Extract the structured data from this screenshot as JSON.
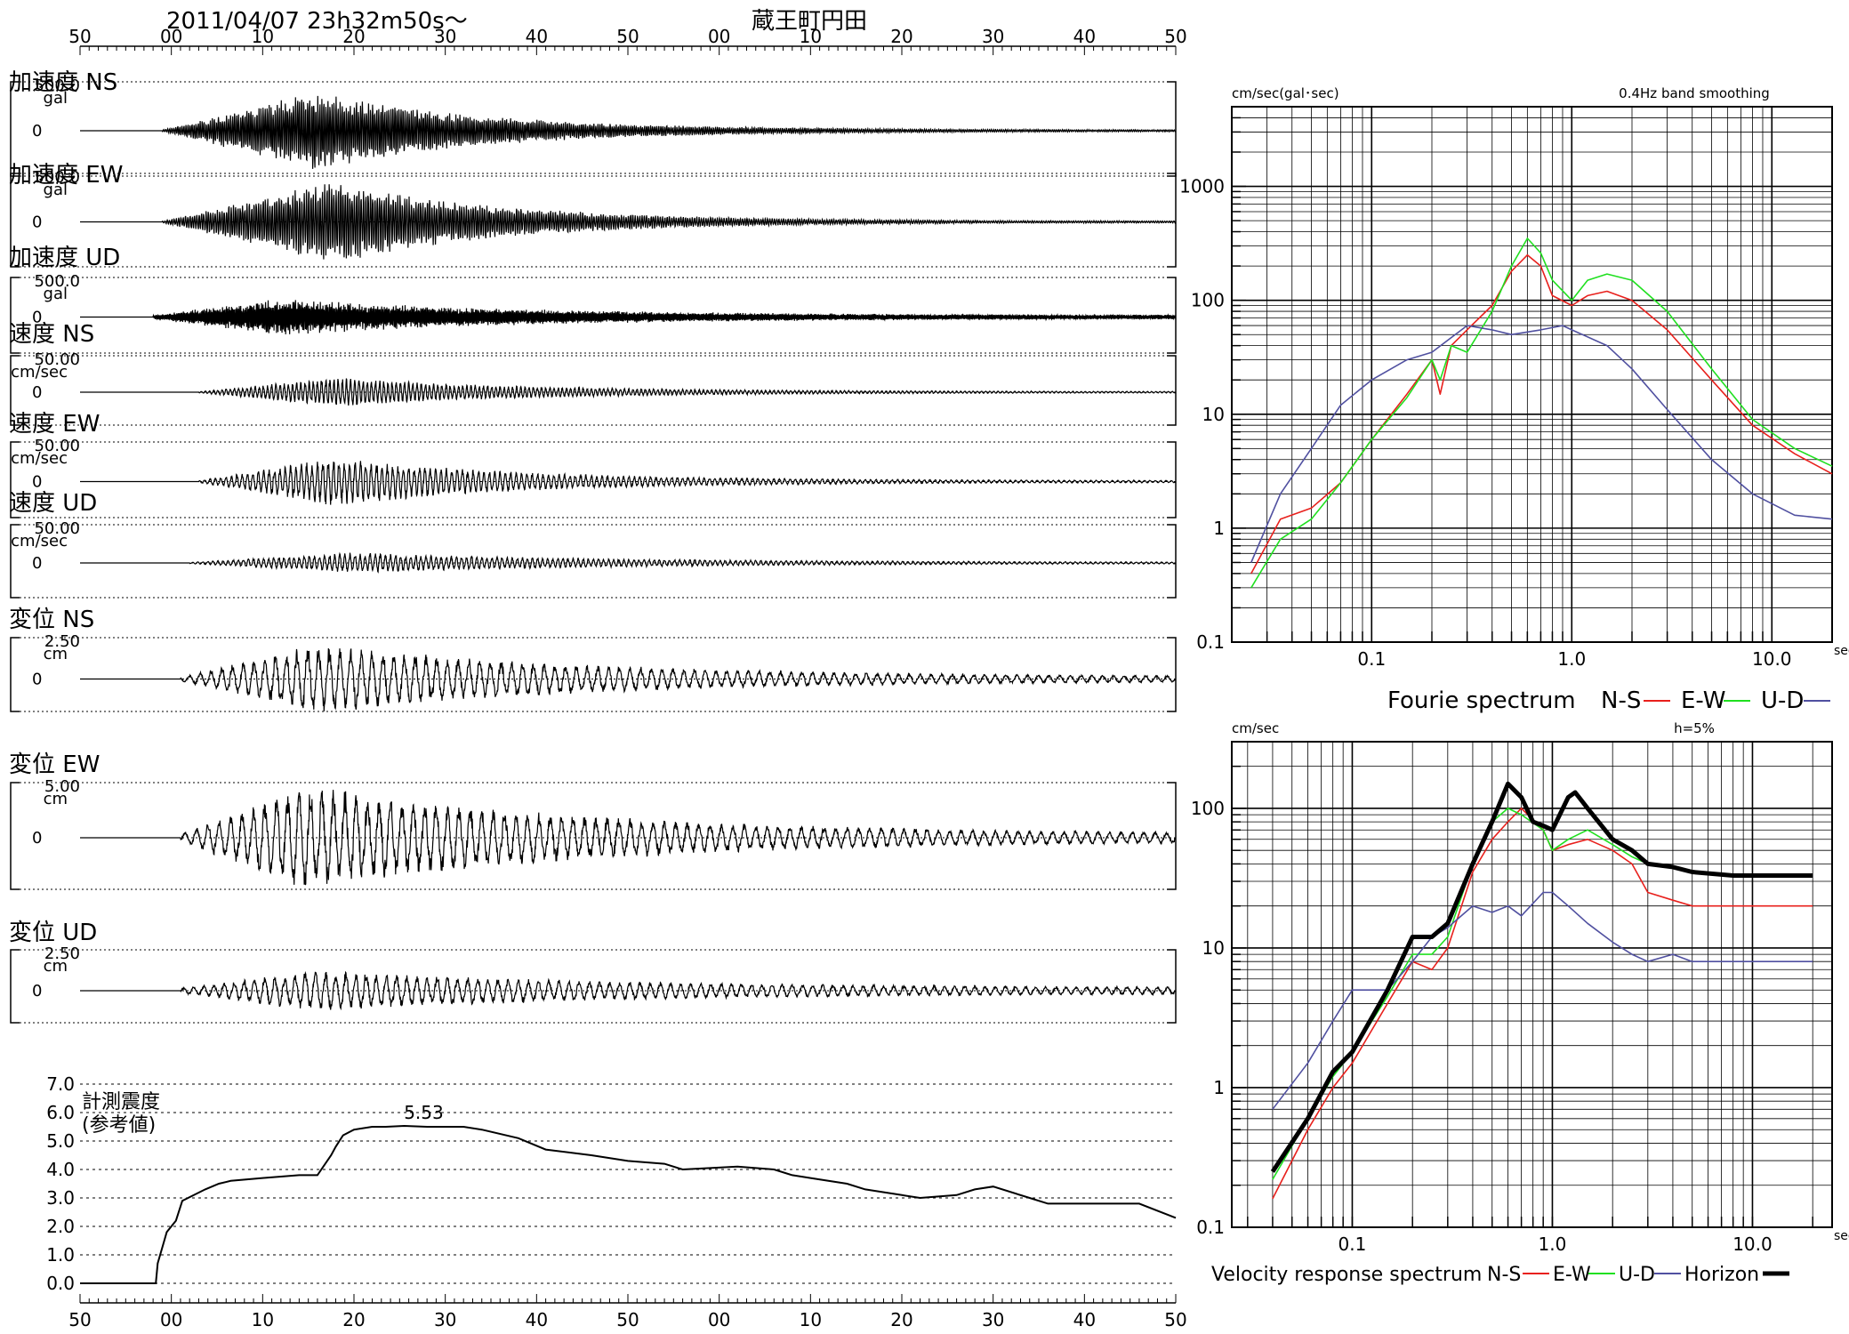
{
  "header": {
    "datetime": "2011/04/07  23h32m50s～",
    "station": "蔵王町円田"
  },
  "time_axis": {
    "ticks": [
      "50",
      "00",
      "10",
      "20",
      "30",
      "40",
      "50",
      "00",
      "10",
      "20",
      "30",
      "40",
      "50"
    ]
  },
  "waveform_panels": [
    {
      "title": "加速度 NS",
      "scale": "500.0",
      "unit": "gal",
      "zero": "0"
    },
    {
      "title": "加速度 EW",
      "scale": "500.0",
      "unit": "gal",
      "zero": "0"
    },
    {
      "title": "加速度 UD",
      "scale": "500.0",
      "unit": "gal",
      "zero": "0"
    },
    {
      "title": "速度 NS",
      "scale": "50.00",
      "unit": "cm/sec",
      "zero": "0"
    },
    {
      "title": "速度 EW",
      "scale": "50.00",
      "unit": "cm/sec",
      "zero": "0"
    },
    {
      "title": "速度 UD",
      "scale": "50.00",
      "unit": "cm/sec",
      "zero": "0"
    },
    {
      "title": "変位 NS",
      "scale": "2.50",
      "unit": "cm",
      "zero": "0"
    },
    {
      "title": "変位 EW",
      "scale": "5.00",
      "unit": "cm",
      "zero": "0"
    },
    {
      "title": "変位 UD",
      "scale": "2.50",
      "unit": "cm",
      "zero": "0"
    }
  ],
  "intensity_panel": {
    "label_line1": "計測震度",
    "label_line2": "(参考値)",
    "y_ticks": [
      "7.0",
      "6.0",
      "5.0",
      "4.0",
      "3.0",
      "2.0",
      "1.0",
      "0.0"
    ],
    "peak_label": "5.53"
  },
  "fourier_panel": {
    "ylabel": "cm/sec(gal･sec)",
    "note": "0.4Hz band smoothing",
    "y_ticks": [
      "1000",
      "100",
      "10",
      "1",
      "0.1"
    ],
    "x_ticks": [
      "0.1",
      "1.0",
      "10.0"
    ],
    "x_unit": "sec",
    "title": "Fourie spectrum",
    "legend": [
      {
        "label": "N-S",
        "color": "#e8201c"
      },
      {
        "label": "E-W",
        "color": "#20e020"
      },
      {
        "label": "U-D",
        "color": "#5050a0"
      }
    ]
  },
  "response_panel": {
    "ylabel": "cm/sec",
    "note": "h=5%",
    "y_ticks": [
      "100",
      "10",
      "1",
      "0.1"
    ],
    "x_ticks": [
      "0.1",
      "1.0",
      "10.0"
    ],
    "x_unit": "sec",
    "title": "Velocity response spectrum",
    "legend": [
      {
        "label": "N-S",
        "color": "#e8201c"
      },
      {
        "label": "E-W",
        "color": "#20e020"
      },
      {
        "label": "U-D",
        "color": "#5050a0"
      },
      {
        "label": "Horizon",
        "color": "#000000"
      }
    ]
  },
  "chart_data": [
    {
      "type": "line",
      "name": "計測震度 (参考値)",
      "x_unit": "seconds after 23h32m50s",
      "x": [
        0,
        8.3,
        8.5,
        9.5,
        10.5,
        11.2,
        13.7,
        15.2,
        16.5,
        20,
        24,
        26,
        27.5,
        28,
        28.8,
        30,
        32,
        33.5,
        35.5,
        38,
        42,
        44,
        48,
        51,
        56,
        60,
        64,
        66,
        72,
        76,
        78,
        80,
        84,
        86,
        90,
        92,
        96,
        98,
        100,
        104,
        106,
        110,
        116,
        120
      ],
      "y": [
        0.0,
        0.0,
        0.7,
        1.8,
        2.2,
        2.9,
        3.3,
        3.5,
        3.6,
        3.7,
        3.8,
        3.8,
        4.5,
        4.8,
        5.2,
        5.4,
        5.5,
        5.5,
        5.53,
        5.5,
        5.5,
        5.4,
        5.1,
        4.7,
        4.5,
        4.3,
        4.2,
        4.0,
        4.1,
        4.0,
        3.8,
        3.7,
        3.5,
        3.3,
        3.1,
        3.0,
        3.1,
        3.3,
        3.4,
        3.0,
        2.8,
        2.8,
        2.8,
        2.3
      ],
      "ylim": [
        0,
        7
      ],
      "peak": 5.53
    },
    {
      "type": "line",
      "name": "Fourie spectrum",
      "x_scale": "log",
      "y_scale": "log",
      "xlim": [
        0.02,
        20
      ],
      "ylim": [
        0.1,
        5000
      ],
      "series": [
        {
          "name": "N-S",
          "color": "#e8201c",
          "x": [
            0.025,
            0.035,
            0.05,
            0.07,
            0.1,
            0.15,
            0.2,
            0.22,
            0.25,
            0.3,
            0.4,
            0.5,
            0.6,
            0.7,
            0.8,
            1.0,
            1.2,
            1.5,
            2,
            3,
            5,
            8,
            13,
            20
          ],
          "y": [
            0.4,
            1.2,
            1.5,
            2.5,
            6,
            15,
            30,
            15,
            40,
            55,
            90,
            180,
            250,
            200,
            110,
            90,
            110,
            120,
            100,
            55,
            20,
            8,
            4.5,
            3
          ]
        },
        {
          "name": "E-W",
          "color": "#20e020",
          "x": [
            0.025,
            0.035,
            0.05,
            0.07,
            0.1,
            0.15,
            0.2,
            0.22,
            0.25,
            0.3,
            0.4,
            0.5,
            0.6,
            0.7,
            0.8,
            1.0,
            1.2,
            1.5,
            2,
            3,
            5,
            8,
            13,
            20
          ],
          "y": [
            0.3,
            0.8,
            1.2,
            2.5,
            6,
            14,
            30,
            20,
            40,
            35,
            80,
            200,
            350,
            260,
            150,
            100,
            150,
            170,
            150,
            80,
            25,
            9,
            5,
            3.5
          ]
        },
        {
          "name": "U-D",
          "color": "#5050a0",
          "x": [
            0.025,
            0.035,
            0.05,
            0.07,
            0.1,
            0.15,
            0.2,
            0.3,
            0.4,
            0.5,
            0.7,
            0.9,
            1.0,
            1.5,
            2,
            3,
            5,
            8,
            13,
            20
          ],
          "y": [
            0.5,
            2,
            5,
            12,
            20,
            30,
            35,
            60,
            55,
            50,
            55,
            60,
            55,
            40,
            25,
            11,
            4,
            2,
            1.3,
            1.2
          ]
        }
      ]
    },
    {
      "type": "line",
      "name": "Velocity response spectrum",
      "x_scale": "log",
      "y_scale": "log",
      "xlim": [
        0.025,
        25
      ],
      "ylim": [
        0.1,
        300
      ],
      "series": [
        {
          "name": "N-S",
          "color": "#e8201c",
          "x": [
            0.04,
            0.06,
            0.08,
            0.1,
            0.15,
            0.2,
            0.25,
            0.3,
            0.4,
            0.5,
            0.6,
            0.7,
            0.9,
            1.0,
            1.2,
            1.5,
            2,
            2.5,
            3,
            4,
            5,
            8,
            12,
            20
          ],
          "y": [
            0.16,
            0.5,
            1.0,
            1.5,
            4,
            8,
            7,
            10,
            35,
            60,
            80,
            100,
            70,
            50,
            55,
            60,
            50,
            40,
            25,
            22,
            20,
            20,
            20,
            20
          ]
        },
        {
          "name": "E-W",
          "color": "#20e020",
          "x": [
            0.04,
            0.06,
            0.08,
            0.1,
            0.15,
            0.2,
            0.25,
            0.3,
            0.4,
            0.5,
            0.6,
            0.7,
            0.9,
            1.0,
            1.2,
            1.5,
            2,
            2.5,
            3
          ],
          "y": [
            0.22,
            0.6,
            1.2,
            1.8,
            4.5,
            9,
            9,
            12,
            40,
            80,
            100,
            90,
            70,
            50,
            60,
            70,
            55,
            45,
            40
          ]
        },
        {
          "name": "U-D",
          "color": "#5050a0",
          "x": [
            0.04,
            0.06,
            0.08,
            0.1,
            0.12,
            0.15,
            0.2,
            0.25,
            0.3,
            0.4,
            0.5,
            0.6,
            0.7,
            0.9,
            1.0,
            1.2,
            1.5,
            2,
            2.5,
            3,
            4,
            5,
            8,
            12,
            20
          ],
          "y": [
            0.7,
            1.5,
            3,
            5,
            5,
            5,
            8,
            12,
            14,
            20,
            18,
            20,
            17,
            25,
            25,
            20,
            15,
            11,
            9,
            8,
            9,
            8,
            8,
            8,
            8
          ]
        },
        {
          "name": "Horizon",
          "color": "#000000",
          "x": [
            0.04,
            0.06,
            0.08,
            0.1,
            0.15,
            0.2,
            0.25,
            0.3,
            0.4,
            0.5,
            0.6,
            0.7,
            0.8,
            0.9,
            1.0,
            1.2,
            1.3,
            1.5,
            1.7,
            2,
            2.5,
            3,
            4,
            5,
            8,
            12,
            20
          ],
          "y": [
            0.25,
            0.6,
            1.3,
            1.8,
            5,
            12,
            12,
            15,
            40,
            80,
            150,
            120,
            80,
            75,
            70,
            120,
            130,
            100,
            80,
            60,
            50,
            40,
            38,
            35,
            33,
            33,
            33
          ]
        }
      ]
    }
  ]
}
